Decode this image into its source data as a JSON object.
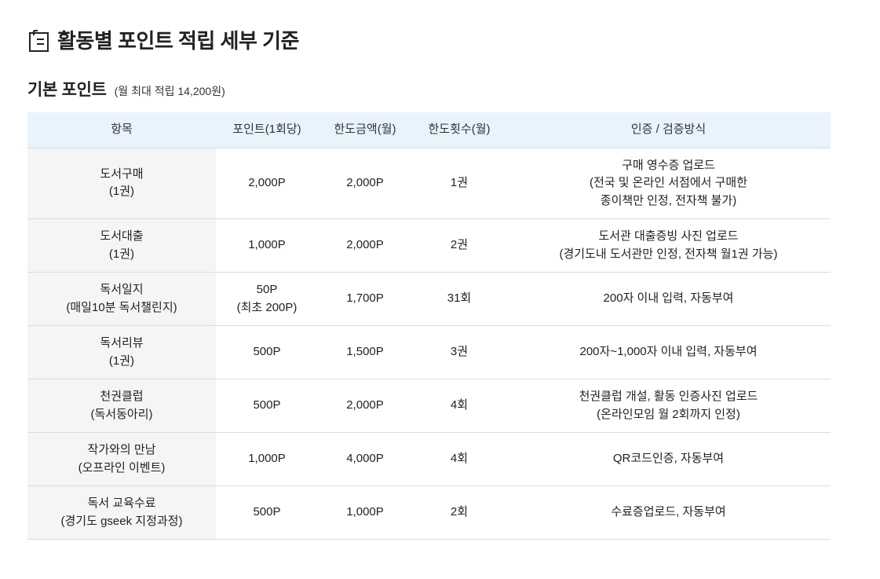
{
  "page": {
    "title": "활동별 포인트 적립 세부 기준",
    "icon": "notepad-icon"
  },
  "section": {
    "title": "기본 포인트",
    "note": "(월 최대 적립 14,200원)"
  },
  "colors": {
    "header_bg": "#e8f3fc",
    "item_col_bg": "#f5f5f5",
    "border": "#dcdcdc",
    "text": "#222222"
  },
  "table": {
    "headers": [
      "항목",
      "포인트(1회당)",
      "한도금액(월)",
      "한도횟수(월)",
      "인증 / 검증방식"
    ],
    "rows": [
      {
        "item": [
          "도서구매",
          "(1권)"
        ],
        "point": [
          "2,000P"
        ],
        "limit_amount": "2,000P",
        "limit_count": "1권",
        "method": [
          "구매 영수증 업로드",
          "(전국 및 온라인 서점에서 구매한",
          "종이책만 인정, 전자책 불가)"
        ]
      },
      {
        "item": [
          "도서대출",
          "(1권)"
        ],
        "point": [
          "1,000P"
        ],
        "limit_amount": "2,000P",
        "limit_count": "2권",
        "method": [
          "도서관 대출증빙 사진 업로드",
          "(경기도내 도서관만 인정, 전자책 월1권 가능)"
        ]
      },
      {
        "item": [
          "독서일지",
          "(매일10분 독서챌린지)"
        ],
        "point": [
          "50P",
          "(최초 200P)"
        ],
        "limit_amount": "1,700P",
        "limit_count": "31회",
        "method": [
          "200자 이내 입력, 자동부여"
        ]
      },
      {
        "item": [
          "독서리뷰",
          "(1권)"
        ],
        "point": [
          "500P"
        ],
        "limit_amount": "1,500P",
        "limit_count": "3권",
        "method": [
          "200자~1,000자 이내 입력, 자동부여"
        ]
      },
      {
        "item": [
          "천권클럽",
          "(독서동아리)"
        ],
        "point": [
          "500P"
        ],
        "limit_amount": "2,000P",
        "limit_count": "4회",
        "method": [
          "천권클럽 개설, 활동 인증사진 업로드",
          "(온라인모임 월 2회까지 인정)"
        ]
      },
      {
        "item": [
          "작가와의 만남",
          "(오프라인 이벤트)"
        ],
        "point": [
          "1,000P"
        ],
        "limit_amount": "4,000P",
        "limit_count": "4회",
        "method": [
          "QR코드인증, 자동부여"
        ]
      },
      {
        "item": [
          "독서 교육수료",
          "(경기도 gseek 지정과정)"
        ],
        "point": [
          "500P"
        ],
        "limit_amount": "1,000P",
        "limit_count": "2회",
        "method": [
          "수료증업로드, 자동부여"
        ]
      }
    ]
  }
}
